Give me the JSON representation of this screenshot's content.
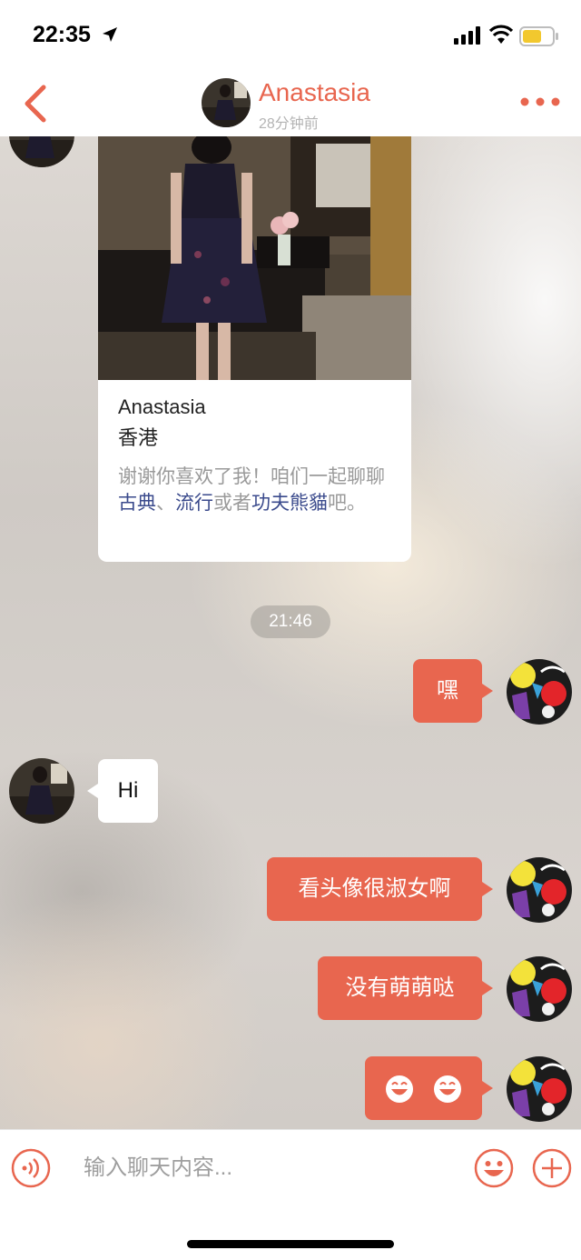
{
  "status_bar": {
    "time": "22:35",
    "icons": [
      "location-arrow-icon",
      "signal-bars-icon",
      "wifi-icon",
      "battery-icon"
    ]
  },
  "header": {
    "contact_name": "Anastasia",
    "last_seen": "28分钟前",
    "back_icon": "chevron-left-icon",
    "more_icon": "more-dots-icon"
  },
  "profile_card": {
    "name": "Anastasia",
    "city": "香港",
    "message_parts": [
      {
        "text": "谢谢你喜欢了我！咱们一起聊聊",
        "highlight": false
      },
      {
        "text": "古典",
        "highlight": true
      },
      {
        "text": "、",
        "highlight": false
      },
      {
        "text": "流行",
        "highlight": true
      },
      {
        "text": "或者",
        "highlight": false
      },
      {
        "text": "功夫熊貓",
        "highlight": true
      },
      {
        "text": "吧。",
        "highlight": false
      }
    ]
  },
  "timestamp": "21:46",
  "messages": [
    {
      "direction": "out",
      "text": "嘿"
    },
    {
      "direction": "in",
      "text": "Hi"
    },
    {
      "direction": "out",
      "text": "看头像很淑女啊"
    },
    {
      "direction": "out",
      "text": "没有萌萌哒"
    },
    {
      "direction": "out",
      "text": "",
      "emoji": [
        "grinning-face-icon",
        "grinning-face-icon"
      ]
    }
  ],
  "input_bar": {
    "placeholder": "输入聊天内容...",
    "value": "",
    "voice_icon": "voice-icon",
    "emoji_icon": "smiley-icon",
    "plus_icon": "plus-icon"
  },
  "colors": {
    "accent": "#e8664f",
    "highlight_text": "#3a4a8c",
    "muted_text": "#9a9a9a"
  }
}
